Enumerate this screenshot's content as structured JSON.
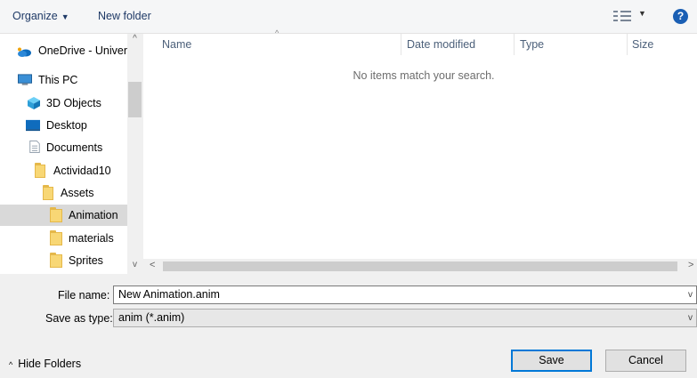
{
  "toolbar": {
    "organize_label": "Organize",
    "new_folder_label": "New folder",
    "help_label": "?"
  },
  "nav": {
    "items": [
      {
        "label": "OneDrive - Univer",
        "icon": "onedrive-icon"
      },
      {
        "label": "This PC",
        "icon": "computer-icon"
      },
      {
        "label": "3D Objects",
        "icon": "3d-objects-icon"
      },
      {
        "label": "Desktop",
        "icon": "desktop-icon"
      },
      {
        "label": "Documents",
        "icon": "documents-icon"
      },
      {
        "label": "Actividad10",
        "icon": "folder-icon"
      },
      {
        "label": "Assets",
        "icon": "folder-icon"
      },
      {
        "label": "Animation",
        "icon": "folder-icon",
        "selected": true
      },
      {
        "label": "materials",
        "icon": "folder-icon"
      },
      {
        "label": "Sprites",
        "icon": "folder-icon"
      }
    ]
  },
  "columns": {
    "name": "Name",
    "date_modified": "Date modified",
    "type": "Type",
    "size": "Size"
  },
  "content": {
    "empty_message": "No items match your search."
  },
  "form": {
    "file_name_label": "File name:",
    "file_name_value": "New Animation.anim",
    "save_as_type_label": "Save as type:",
    "save_as_type_value": "anim (*.anim)"
  },
  "footer": {
    "hide_folders_label": "Hide Folders",
    "save_label": "Save",
    "cancel_label": "Cancel"
  },
  "colors": {
    "accent": "#0078d7",
    "help": "#1a5fb4",
    "selection": "#d9d9d9"
  }
}
